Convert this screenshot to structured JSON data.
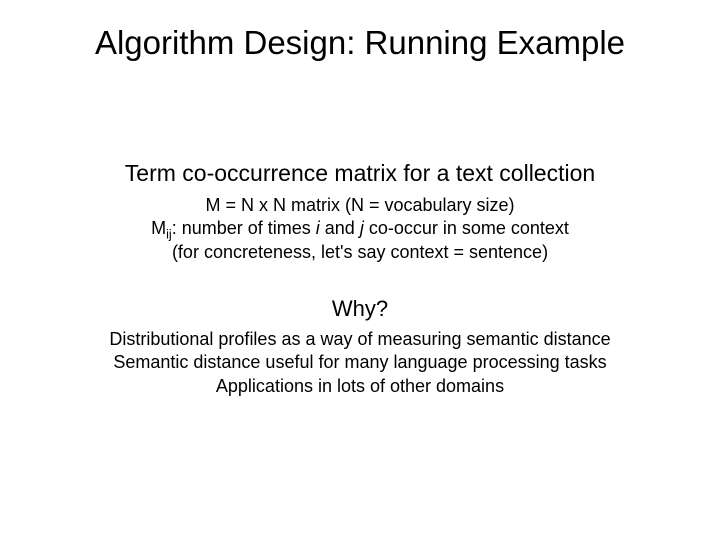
{
  "title": "Algorithm Design: Running Example",
  "subtitle": "Term co-occurrence matrix for a text collection",
  "def": {
    "line1_a": "M = N x N matrix (N = vocabulary size)",
    "line2_a": "M",
    "line2_sub": "ij",
    "line2_b": ": number of times ",
    "line2_i": "i",
    "line2_c": " and ",
    "line2_j": "j",
    "line2_d": " co-occur in some context",
    "line3": "(for concreteness, let's say context = sentence)"
  },
  "why_label": "Why?",
  "why": {
    "line1": "Distributional profiles as a way of measuring semantic distance",
    "line2": "Semantic distance useful for many language processing tasks",
    "line3": "Applications in lots of other domains"
  }
}
